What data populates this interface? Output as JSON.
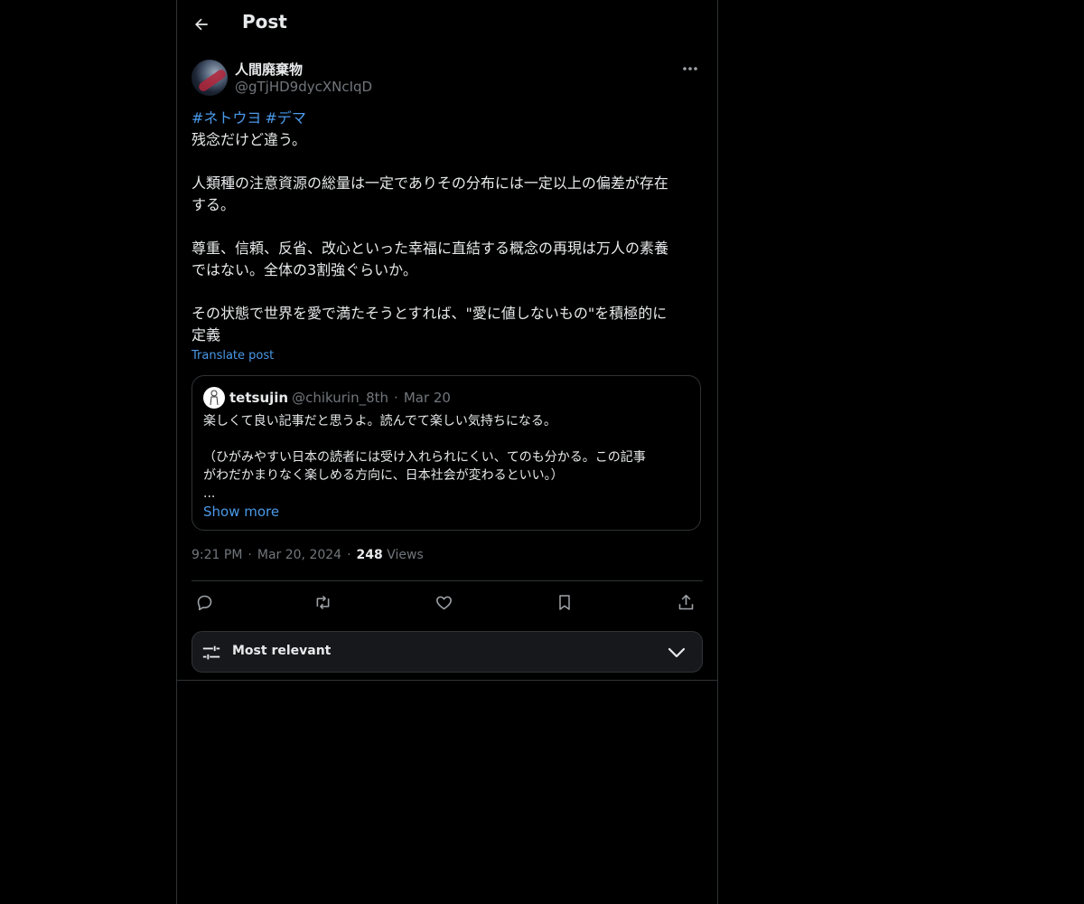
{
  "header": {
    "title": "Post"
  },
  "post": {
    "author_name": "人間廃棄物",
    "author_handle": "@gTjHD9dycXNcIqD",
    "hashtags": [
      "#ネトウヨ",
      "#デマ"
    ],
    "paragraphs": [
      [
        "残念だけど違う。"
      ],
      [
        "人類種の注意資源の総量は一定でありその分布には一定以上の偏差が存在",
        "する。"
      ],
      [
        "尊重、信頼、反省、改心といった幸福に直結する概念の再現は万人の素養",
        "ではない。全体の3割強ぐらいか。"
      ],
      [
        "その状態で世界を愛で満たそうとすれば、\"愛に値しないもの\"を積極的に",
        "定義"
      ]
    ],
    "translate_label": "Translate post",
    "time": "9:21 PM",
    "date": "Mar 20, 2024",
    "views_count": "248",
    "views_label": "Views"
  },
  "quote": {
    "name": "tetsujin",
    "handle": "@chikurin_8th",
    "date": "Mar 20",
    "lines": [
      "楽しくて良い記事だと思うよ。読んでて楽しい気持ちになる。",
      "",
      "（ひがみやすい日本の読者には受け入れられにくい、てのも分かる。この記事",
      "がわだかまりなく楽しめる方向に、日本社会が変わるといい。）",
      "..."
    ],
    "show_more": "Show more"
  },
  "sort": {
    "label": "Most relevant"
  },
  "colors": {
    "background": "#000000",
    "accent": "#4a99e9",
    "muted": "#71767b",
    "text": "#e7e9ea",
    "border": "#2f3336"
  },
  "icons": [
    "back-arrow-icon",
    "more-dots-icon",
    "reply-icon",
    "repost-icon",
    "like-icon",
    "bookmark-icon",
    "share-icon",
    "sort-sliders-icon",
    "chevron-down-icon"
  ]
}
